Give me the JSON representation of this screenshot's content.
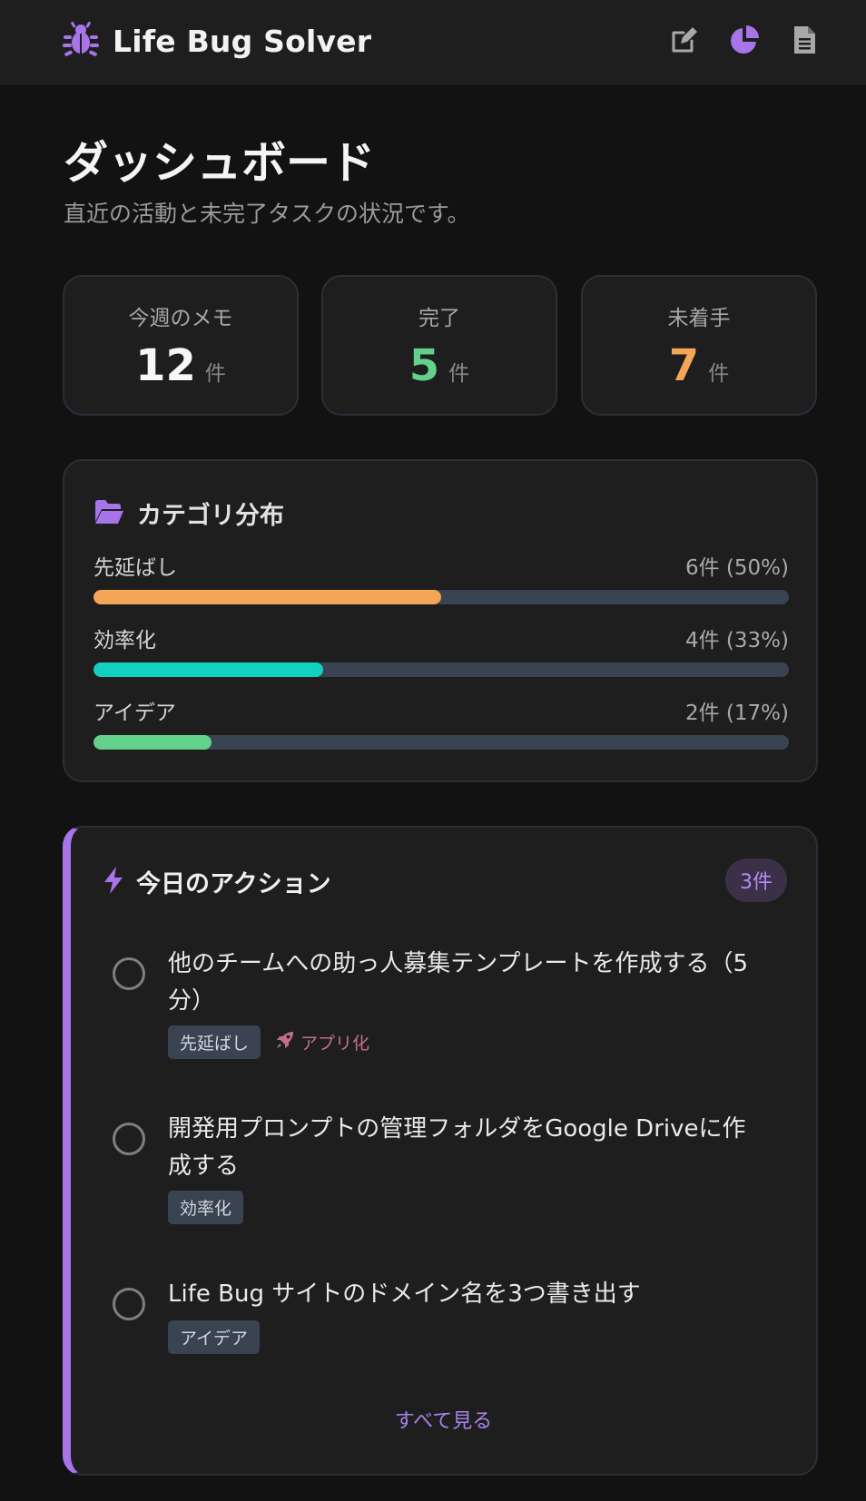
{
  "header": {
    "app_title": "Life Bug Solver",
    "logo_icon": "bug-icon",
    "icons": [
      "edit-icon",
      "pie-chart-icon",
      "document-icon"
    ],
    "accent_color": "#a774e9"
  },
  "page": {
    "title": "ダッシュボード",
    "subtitle": "直近の活動と未完了タスクの状況です。"
  },
  "stats": [
    {
      "label": "今週のメモ",
      "value": "12",
      "unit": "件",
      "color": "#f6f6f6"
    },
    {
      "label": "完了",
      "value": "5",
      "unit": "件",
      "color": "#63d18b"
    },
    {
      "label": "未着手",
      "value": "7",
      "unit": "件",
      "color": "#f4a556"
    }
  ],
  "categories": {
    "title": "カテゴリ分布",
    "icon": "folder-open-icon",
    "items": [
      {
        "name": "先延ばし",
        "count": "6件 (50%)",
        "fraction": 0.5,
        "color": "#f4a556"
      },
      {
        "name": "効率化",
        "count": "4件 (33%)",
        "fraction": 0.33,
        "color": "#12d1c0"
      },
      {
        "name": "アイデア",
        "count": "2件 (17%)",
        "fraction": 0.17,
        "color": "#63d18b"
      }
    ]
  },
  "actions": {
    "title": "今日のアクション",
    "icon": "bolt-icon",
    "badge": "3件",
    "tasks": [
      {
        "text": "他のチームへの助っ人募集テンプレートを作成する（5分）",
        "tag": "先延ばし",
        "extra": "アプリ化",
        "extra_icon": "rocket-icon"
      },
      {
        "text": "開発用プロンプトの管理フォルダをGoogle Driveに作成する",
        "tag": "効率化"
      },
      {
        "text": "Life Bug サイトのドメイン名を3つ書き出す",
        "tag": "アイデア"
      }
    ],
    "see_all": "すべて見る"
  }
}
